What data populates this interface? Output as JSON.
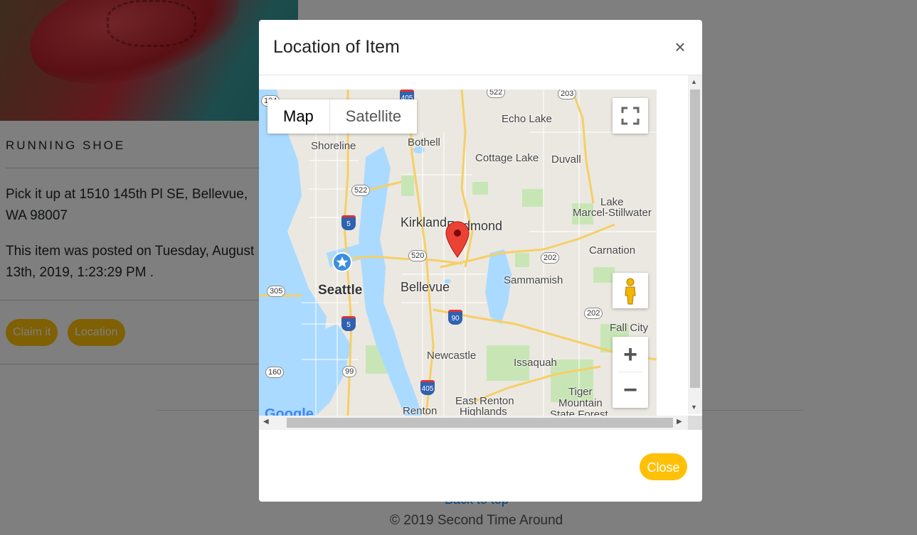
{
  "card": {
    "title": "RUNNING SHOE",
    "address": "Pick it up at 1510 145th Pl SE, Bellevue, WA 98007",
    "posted": "This item was posted on Tuesday, August 13th, 2019, 1:23:29 PM .",
    "claim_label": "Claim it",
    "location_label": "Location"
  },
  "footer": {
    "back_to_top": "Back to top",
    "copyright": "© 2019 Second Time Around"
  },
  "modal": {
    "title": "Location of Item",
    "close_symbol": "×",
    "close_label": "Close"
  },
  "map": {
    "type_options": [
      "Map",
      "Satellite"
    ],
    "selected_type": "Map",
    "zoom_in": "+",
    "zoom_out": "−",
    "google": "Google",
    "labels": {
      "shoreline": "Shoreline",
      "bothell": "Bothell",
      "echo_lake": "Echo Lake",
      "cottage_lake": "Cottage Lake",
      "duvall": "Duvall",
      "kirkland": "Kirkland",
      "redmond": "Redmond",
      "lake_marcel_1": "Lake",
      "lake_marcel_2": "Marcel-Stillwater",
      "carnation": "Carnation",
      "seattle": "Seattle",
      "bellevue": "Bellevue",
      "sammamish": "Sammamish",
      "fall_city": "Fall City",
      "newcastle": "Newcastle",
      "issaquah": "Issaquah",
      "tiger_1": "Tiger",
      "tiger_2": "Mountain",
      "tiger_3": "State Forest",
      "east_renton_1": "East Renton",
      "east_renton_2": "Highlands",
      "renton": "Renton"
    },
    "shields": {
      "s405a": "405",
      "s522a": "522",
      "s203": "203",
      "s522b": "522",
      "s5a": "5",
      "s520": "520",
      "s202a": "202",
      "s305": "305",
      "s90": "90",
      "s202b": "202",
      "s5b": "5",
      "s160": "160",
      "s99": "99",
      "s405b": "405",
      "s104": "104"
    }
  },
  "colors": {
    "accent": "#ffc107",
    "water": "#aadaff",
    "park": "#c8e6b5",
    "road": "#f6cf65",
    "marker": "#ea4335"
  }
}
